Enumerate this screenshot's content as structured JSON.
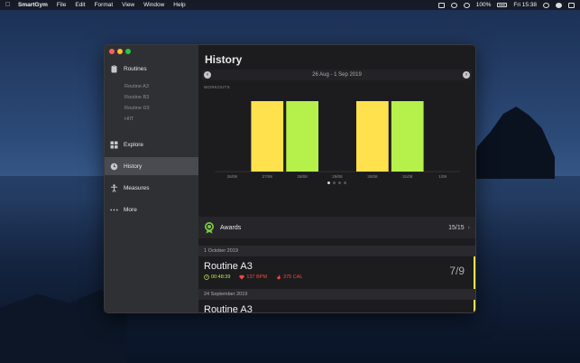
{
  "menubar": {
    "app_name": "SmartGym",
    "menus": [
      "File",
      "Edit",
      "Format",
      "View",
      "Window",
      "Help"
    ],
    "battery": "100%",
    "clock": "Fri 15:38"
  },
  "sidebar": {
    "routines_label": "Routines",
    "routines_sub": [
      "Routine A3",
      "Routine B3",
      "Routine D3",
      "HIIT"
    ],
    "explore_label": "Explore",
    "history_label": "History",
    "measures_label": "Measures",
    "more_label": "More"
  },
  "history": {
    "title": "History",
    "date_range": "26 Aug - 1 Sep 2019",
    "workouts_label": "WORKOUTS"
  },
  "chart_data": {
    "type": "bar",
    "title": "WORKOUTS",
    "categories": [
      "26/08",
      "27/08",
      "28/08",
      "29/08",
      "30/08",
      "31/08",
      "1/09"
    ],
    "values": [
      0,
      1,
      1,
      0,
      1,
      1,
      0
    ],
    "bar_colors": [
      "#ffe14d",
      "#ffe14d",
      "#b6f04b",
      "#ffe14d",
      "#ffe14d",
      "#b6f04b",
      "#ffe14d"
    ],
    "ylim": [
      0,
      1
    ],
    "grid": false,
    "legend": "none"
  },
  "pager": {
    "pages": 4,
    "current": 0
  },
  "awards": {
    "label": "Awards",
    "count": "15/15"
  },
  "sections": [
    {
      "date": "1 October 2019",
      "workout": {
        "name": "Routine A3",
        "duration": "00:48:39",
        "heart_rate": "137 BPM",
        "calories": "375 CAL",
        "progress": "7/9"
      }
    },
    {
      "date": "24 September 2019",
      "workout": {
        "name": "Routine A3",
        "duration": "",
        "heart_rate": "",
        "calories": "",
        "progress": ""
      }
    }
  ],
  "colors": {
    "yellow_bar": "#ffe14d",
    "green_bar": "#b6f04b",
    "accent": "#ffe14d"
  }
}
